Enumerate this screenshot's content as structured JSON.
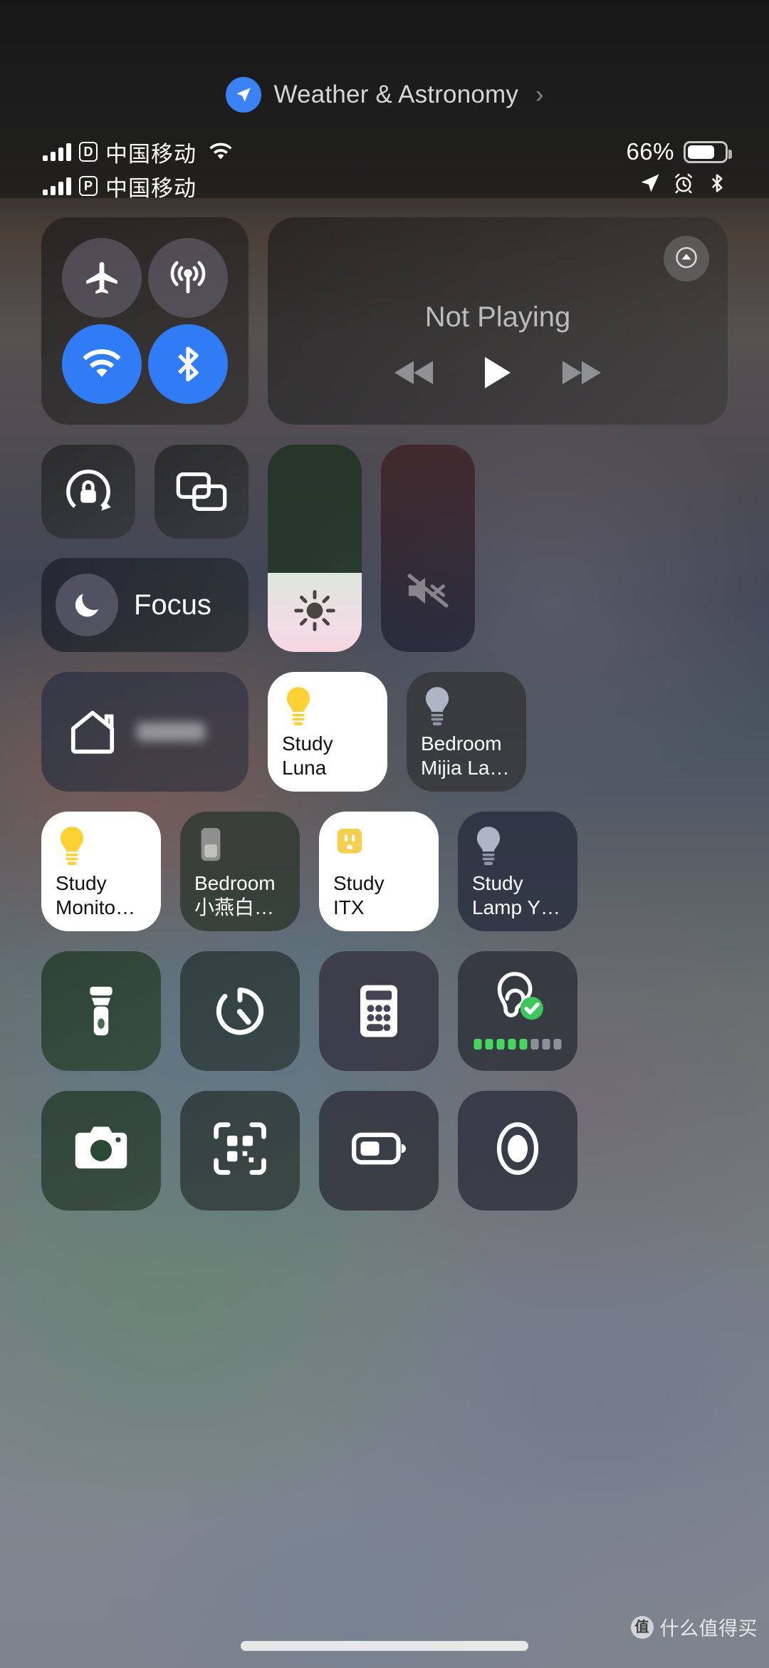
{
  "banner": {
    "icon": "location-arrow-icon",
    "label": "Weather & Astronomy",
    "chevron": "›"
  },
  "status_bar": {
    "line1": {
      "sim_badge": "D",
      "carrier": "中国移动",
      "wifi_icon": "wifi-icon"
    },
    "line2": {
      "sim_badge": "P",
      "carrier": "中国移动"
    },
    "battery_percent": "66%",
    "battery_level": 66,
    "indicator_icons": [
      "location-arrow-icon",
      "alarm-clock-icon",
      "bluetooth-icon"
    ]
  },
  "connectivity": {
    "airplane": {
      "name": "airplane-mode-toggle",
      "icon": "airplane-icon",
      "state": "off"
    },
    "cellular": {
      "name": "cellular-data-toggle",
      "icon": "cellular-antenna-icon",
      "state": "off"
    },
    "wifi": {
      "name": "wifi-toggle",
      "icon": "wifi-icon",
      "state": "on"
    },
    "bluetooth": {
      "name": "bluetooth-toggle",
      "icon": "bluetooth-icon",
      "state": "on"
    }
  },
  "media": {
    "title": "Not Playing",
    "airplay_icon": "airplay-icon",
    "rewind_icon": "rewind-icon",
    "play_icon": "play-icon",
    "forward_icon": "fast-forward-icon"
  },
  "toggles": {
    "rotation_lock": {
      "label": "rotation-lock",
      "icon": "rotation-lock-icon"
    },
    "screen_mirroring": {
      "label": "screen-mirroring",
      "icon": "screen-mirroring-icon"
    },
    "focus": {
      "label": "Focus",
      "icon": "moon-icon"
    }
  },
  "sliders": {
    "brightness": {
      "name": "brightness-slider",
      "icon": "brightness-sun-icon",
      "value": 38
    },
    "volume": {
      "name": "volume-slider",
      "icon": "speaker-muted-icon",
      "value": 0
    }
  },
  "home": {
    "tile_label": "",
    "icon": "home-house-icon",
    "accessories": [
      {
        "name": "Study Luna",
        "line1": "Study",
        "line2": "Luna",
        "icon": "lightbulb-icon",
        "state": "on",
        "accent": "#ffd233"
      },
      {
        "name": "Bedroom Mijia La…",
        "line1": "Bedroom",
        "line2": "Mijia La…",
        "icon": "lightbulb-icon",
        "state": "off",
        "accent": "#aeb6c6"
      },
      {
        "name": "Study Monito…",
        "line1": "Study",
        "line2": "Monito…",
        "icon": "lightbulb-icon",
        "state": "on",
        "accent": "#ffd233"
      },
      {
        "name": "Bedroom 小燕白…",
        "line1": "Bedroom",
        "line2": "小燕白…",
        "icon": "switch-icon",
        "state": "off",
        "accent": "#9b9b9b"
      },
      {
        "name": "Study ITX",
        "line1": "Study",
        "line2": "ITX",
        "icon": "outlet-icon",
        "state": "on",
        "accent": "#f5cf4e"
      },
      {
        "name": "Study Lamp Y…",
        "line1": "Study",
        "line2": "Lamp Y…",
        "icon": "lightbulb-icon",
        "state": "off",
        "accent": "#aeb6c6"
      }
    ]
  },
  "utilities": [
    {
      "name": "flashlight",
      "icon": "flashlight-icon"
    },
    {
      "name": "timer",
      "icon": "timer-icon"
    },
    {
      "name": "calculator",
      "icon": "calculator-icon"
    },
    {
      "name": "hearing",
      "icon": "hearing-ear-icon",
      "badge": "check-badge",
      "levels_total": 8,
      "levels_lit": 5
    }
  ],
  "utilities_bottom": [
    {
      "name": "camera",
      "icon": "camera-icon"
    },
    {
      "name": "code-scanner",
      "icon": "qr-scan-icon"
    },
    {
      "name": "low-power-mode",
      "icon": "battery-low-power-icon"
    },
    {
      "name": "screen-record",
      "icon": "screen-record-icon"
    }
  ],
  "watermark": {
    "badge": "值",
    "text": "什么值得买"
  }
}
